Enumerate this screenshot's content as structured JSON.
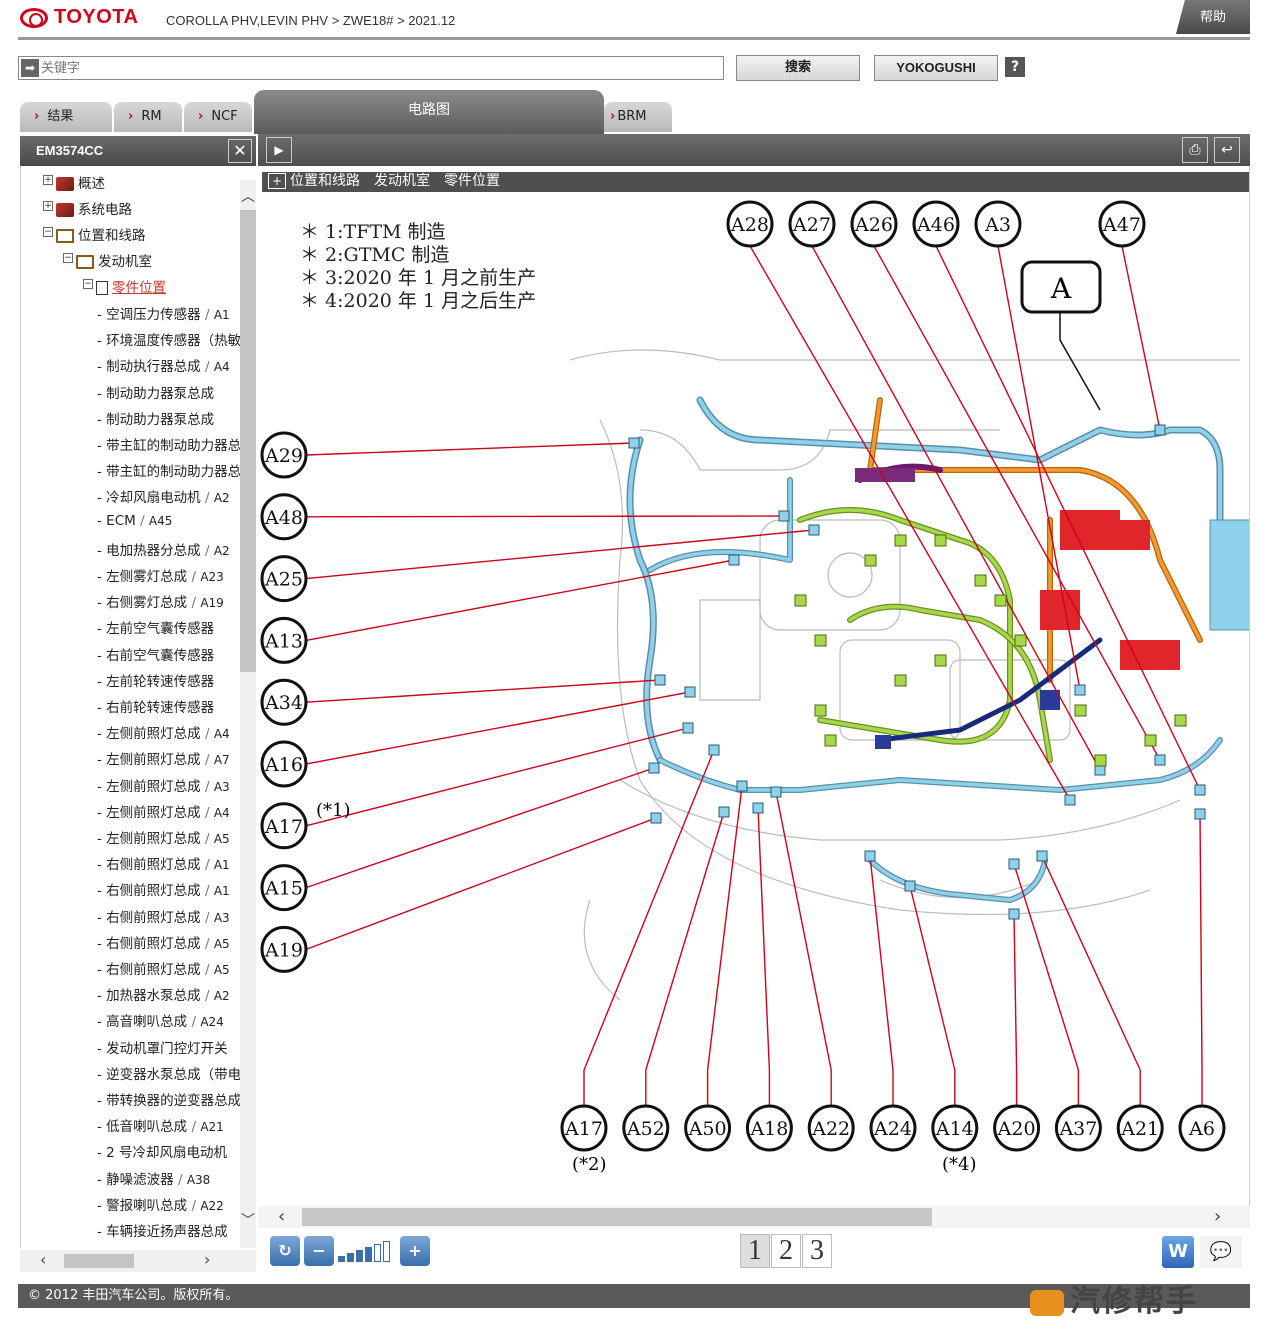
{
  "header": {
    "logo": "TOYOTA",
    "breadcrumb": "COROLLA PHV,LEVIN PHV > ZWE18# > 2021.12",
    "help": "帮助"
  },
  "search": {
    "placeholder": "关键字",
    "search_label": "搜索",
    "yoko_label": "YOKOGUSHI",
    "help_q": "?"
  },
  "tabs": [
    {
      "label": "结果"
    },
    {
      "label": "RM"
    },
    {
      "label": "NCF"
    },
    {
      "label": "电路图"
    },
    {
      "label": "BRM"
    }
  ],
  "left_panel": {
    "title": "EM3574CC",
    "close": "✕",
    "tree": [
      {
        "label": "概述"
      },
      {
        "label": "系统电路"
      },
      {
        "label": "位置和线路"
      },
      {
        "label": "发动机室"
      },
      {
        "label": "零件位置"
      }
    ],
    "items": [
      {
        "name": "空调压力传感器",
        "code": "A1"
      },
      {
        "name": "环境温度传感器（热敏",
        "code": ""
      },
      {
        "name": "制动执行器总成",
        "code": "A4"
      },
      {
        "name": "制动助力器泵总成",
        "code": ""
      },
      {
        "name": "制动助力器泵总成",
        "code": ""
      },
      {
        "name": "带主缸的制动助力器总",
        "code": ""
      },
      {
        "name": "带主缸的制动助力器总",
        "code": ""
      },
      {
        "name": "冷却风扇电动机",
        "code": "A2"
      },
      {
        "name": "ECM",
        "code": "A45"
      },
      {
        "name": "电加热器分总成",
        "code": "A2"
      },
      {
        "name": "左侧雾灯总成",
        "code": "A23"
      },
      {
        "name": "右侧雾灯总成",
        "code": "A19"
      },
      {
        "name": "左前空气囊传感器",
        "code": ""
      },
      {
        "name": "右前空气囊传感器",
        "code": ""
      },
      {
        "name": "左前轮转速传感器",
        "code": ""
      },
      {
        "name": "右前轮转速传感器",
        "code": ""
      },
      {
        "name": "左侧前照灯总成",
        "code": "A4"
      },
      {
        "name": "左侧前照灯总成",
        "code": "A7"
      },
      {
        "name": "左侧前照灯总成",
        "code": "A3"
      },
      {
        "name": "左侧前照灯总成",
        "code": "A4"
      },
      {
        "name": "左侧前照灯总成",
        "code": "A5"
      },
      {
        "name": "右侧前照灯总成",
        "code": "A1"
      },
      {
        "name": "右侧前照灯总成",
        "code": "A1"
      },
      {
        "name": "右侧前照灯总成",
        "code": "A3"
      },
      {
        "name": "右侧前照灯总成",
        "code": "A5"
      },
      {
        "name": "右侧前照灯总成",
        "code": "A5"
      },
      {
        "name": "加热器水泵总成",
        "code": "A2"
      },
      {
        "name": "高音喇叭总成",
        "code": "A24"
      },
      {
        "name": "发动机罩门控灯开关",
        "code": ""
      },
      {
        "name": "逆变器水泵总成（带电",
        "code": ""
      },
      {
        "name": "带转换器的逆变器总成",
        "code": ""
      },
      {
        "name": "低音喇叭总成",
        "code": "A21"
      },
      {
        "name": "2 号冷却风扇电动机",
        "code": ""
      },
      {
        "name": "静噪滤波器",
        "code": "A38"
      },
      {
        "name": "警报喇叭总成",
        "code": "A22"
      },
      {
        "name": "车辆接近扬声器总成",
        "code": ""
      }
    ]
  },
  "diagram": {
    "title_parts": [
      "位置和线路",
      "发动机室",
      "零件位置"
    ],
    "notes": [
      "＊ 1:TFTM 制造",
      "＊ 2:GTMC 制造",
      "＊ 3:2020 年 1 月之前生产",
      "＊ 4:2020 年 1 月之后生产"
    ],
    "label_a": "A",
    "top_labels": [
      "A28",
      "A27",
      "A26",
      "A46",
      "A3",
      "A47"
    ],
    "left_labels": [
      "A29",
      "A48",
      "A25",
      "A13",
      "A34",
      "A16",
      "A17",
      "A15",
      "A19"
    ],
    "left_note": "(*1)",
    "bottom_labels": [
      "A17",
      "A52",
      "A50",
      "A18",
      "A22",
      "A24",
      "A14",
      "A20",
      "A37",
      "A21",
      "A6"
    ],
    "bottom_note_1": "(*2)",
    "bottom_note_2": "(*4)"
  },
  "toolbar": {
    "pages": [
      "1",
      "2",
      "3"
    ],
    "word": "W",
    "zoom_bars": 6
  },
  "footer": {
    "copyright": "© 2012 丰田汽车公司。版权所有。",
    "watermark": "汽修帮手"
  },
  "colors": {
    "brand_red": "#d0021b",
    "harness_blue": "#6db8d6",
    "harness_green": "#8cc63e",
    "harness_orange": "#f08c1e",
    "harness_red": "#e0262a",
    "leader_red": "#d0021b"
  }
}
